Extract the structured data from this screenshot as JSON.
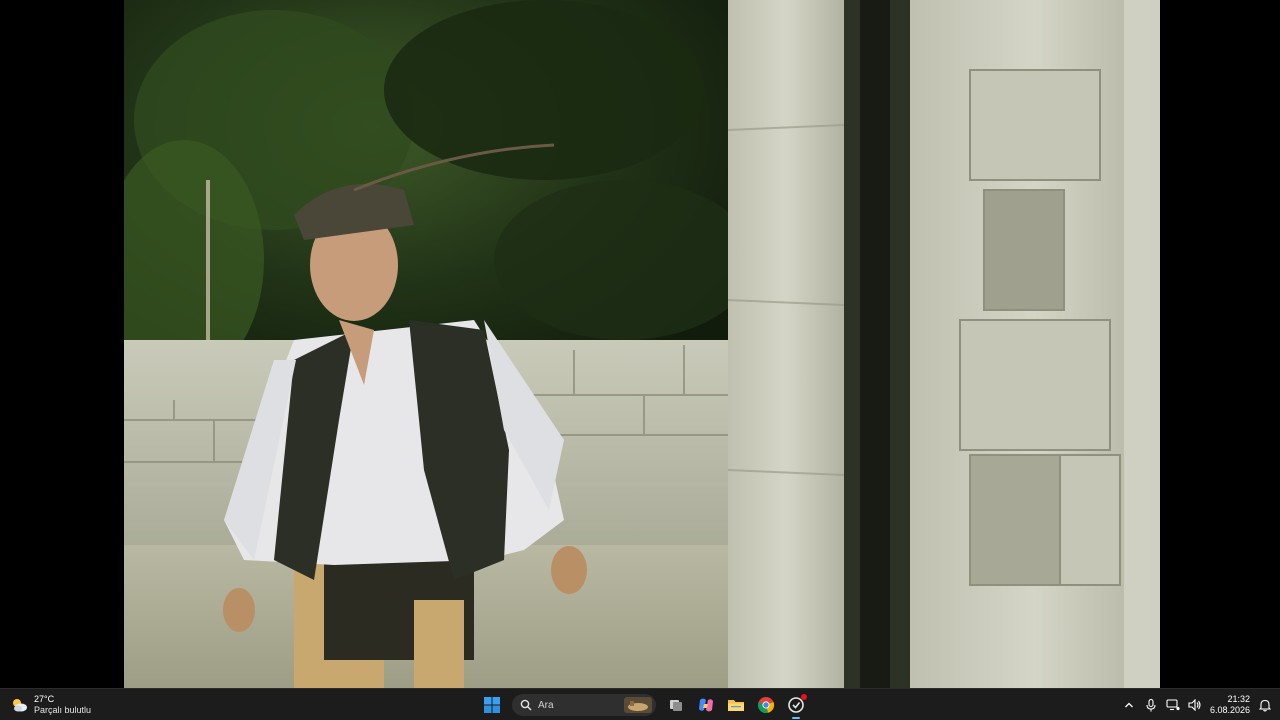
{
  "video": {
    "scene": "film-frame",
    "letterbox_color": "#000000"
  },
  "taskbar": {
    "weather": {
      "temperature": "27°C",
      "condition": "Parçalı bulutlu",
      "icon": "partly-cloudy-icon"
    },
    "start_icon": "windows-start-icon",
    "search": {
      "placeholder": "Ara",
      "icon": "search-icon"
    },
    "pinned_apps": [
      {
        "name": "task-view",
        "icon": "task-view-icon"
      },
      {
        "name": "copilot",
        "icon": "copilot-icon"
      },
      {
        "name": "file-explorer",
        "icon": "folder-icon"
      },
      {
        "name": "chrome",
        "icon": "chrome-icon"
      },
      {
        "name": "active-app",
        "icon": "app-icon",
        "active": true,
        "notification": true
      }
    ],
    "tray": {
      "icons": [
        "chevron-up-icon",
        "microphone-icon",
        "network-icon",
        "volume-icon"
      ],
      "time": "21:32",
      "date": "6.08.2026",
      "notification_icon": "notification-bell-icon"
    },
    "accent_color": "#5ec2ff",
    "background_color": "#1c1c1c"
  }
}
